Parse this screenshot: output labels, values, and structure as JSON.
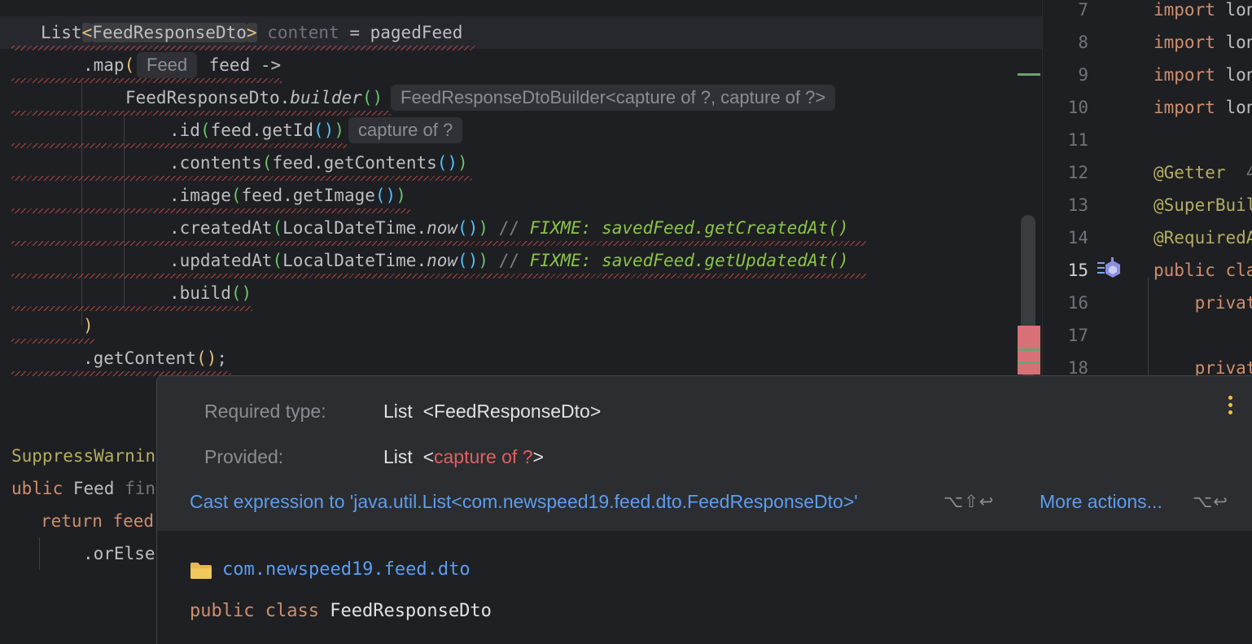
{
  "editor": {
    "lines": [
      {
        "parts": [
          {
            "t": "List"
          },
          {
            "t": "<",
            "cls": "par1 hl-bracket"
          },
          {
            "t": "FeedResponseDto",
            "cls": "hl-bracket"
          },
          {
            "t": ">",
            "cls": "par1 hl-bracket"
          },
          {
            "t": " content",
            "cls": "dim"
          },
          {
            "t": " = pagedFeed"
          }
        ]
      },
      {
        "parts": [
          {
            "t": ".map"
          },
          {
            "t": "(",
            "cls": "par1"
          }
        ]
      },
      {
        "parts": [
          {
            "t": "FeedResponseDto."
          },
          {
            "t": "builder",
            "cls": "italic"
          },
          {
            "t": "()",
            "cls": "par3"
          }
        ]
      },
      {
        "parts": [
          {
            "t": ".id"
          },
          {
            "t": "(",
            "cls": "par3"
          },
          {
            "t": "feed.getId"
          },
          {
            "t": "()",
            "cls": "par2"
          },
          {
            "t": ")",
            "cls": "par3"
          }
        ]
      },
      {
        "parts": [
          {
            "t": ".contents"
          },
          {
            "t": "(",
            "cls": "par3"
          },
          {
            "t": "feed.getContents"
          },
          {
            "t": "()",
            "cls": "par2"
          },
          {
            "t": ")",
            "cls": "par3"
          }
        ]
      },
      {
        "parts": [
          {
            "t": ".image"
          },
          {
            "t": "(",
            "cls": "par3"
          },
          {
            "t": "feed.getImage"
          },
          {
            "t": "()",
            "cls": "par2"
          },
          {
            "t": ")",
            "cls": "par3"
          }
        ]
      },
      {
        "parts": [
          {
            "t": ".createdAt"
          },
          {
            "t": "(",
            "cls": "par3"
          },
          {
            "t": "LocalDateTime."
          },
          {
            "t": "now",
            "cls": "italic"
          },
          {
            "t": "()",
            "cls": "par2"
          },
          {
            "t": ")",
            "cls": "par3"
          },
          {
            "t": " // ",
            "cls": "cmt"
          },
          {
            "t": "FIXME: savedFeed.getCreatedAt()",
            "cls": "todo"
          }
        ]
      },
      {
        "parts": [
          {
            "t": ".updatedAt"
          },
          {
            "t": "(",
            "cls": "par3"
          },
          {
            "t": "LocalDateTime."
          },
          {
            "t": "now",
            "cls": "italic"
          },
          {
            "t": "()",
            "cls": "par2"
          },
          {
            "t": ")",
            "cls": "par3"
          },
          {
            "t": " // ",
            "cls": "cmt"
          },
          {
            "t": "FIXME: savedFeed.getUpdatedAt()",
            "cls": "todo"
          }
        ]
      },
      {
        "parts": [
          {
            "t": ".build"
          },
          {
            "t": "()",
            "cls": "par3"
          }
        ]
      },
      {
        "parts": [
          {
            "t": ")",
            "cls": "par1"
          }
        ]
      },
      {
        "parts": [
          {
            "t": ".getContent"
          },
          {
            "t": "()",
            "cls": "par1"
          },
          {
            "t": ";"
          }
        ]
      },
      {
        "parts": [
          {
            "t": "SuppressWarnin",
            "cls": "anno"
          }
        ]
      },
      {
        "parts": [
          {
            "t": "ublic",
            "cls": "kw"
          },
          {
            "t": " Feed "
          },
          {
            "t": "fin",
            "cls": "dim"
          }
        ]
      },
      {
        "parts": [
          {
            "t": "return",
            "cls": "kw"
          },
          {
            "t": " feed",
            "cls": "kw"
          }
        ]
      },
      {
        "parts": [
          {
            "t": ".orElse"
          }
        ]
      }
    ],
    "map_lambda_param": " feed ->",
    "hints": {
      "feed_type": "Feed",
      "builder_type": "FeedResponseDtoBuilder<capture of ?, capture of ?>",
      "id_type": "capture of ?"
    }
  },
  "right_pane": {
    "rows": [
      {
        "num": "7",
        "code": [
          {
            "t": "import",
            "cls": "kw"
          },
          {
            "t": " lon"
          }
        ]
      },
      {
        "num": "8",
        "code": [
          {
            "t": "import",
            "cls": "kw"
          },
          {
            "t": " lon"
          }
        ]
      },
      {
        "num": "9",
        "code": [
          {
            "t": "import",
            "cls": "kw"
          },
          {
            "t": " lon"
          }
        ]
      },
      {
        "num": "10",
        "code": [
          {
            "t": "import",
            "cls": "kw"
          },
          {
            "t": " lon"
          }
        ]
      },
      {
        "num": "11",
        "code": []
      },
      {
        "num": "12",
        "code": [
          {
            "t": "@Getter",
            "cls": "anno"
          },
          {
            "t": "  4",
            "cls": "dim"
          }
        ]
      },
      {
        "num": "13",
        "code": [
          {
            "t": "@SuperBuil",
            "cls": "anno"
          }
        ]
      },
      {
        "num": "14",
        "code": [
          {
            "t": "@RequiredA",
            "cls": "anno"
          }
        ]
      },
      {
        "num": "15",
        "code": [
          {
            "t": "public",
            "cls": "kw"
          },
          {
            "t": " cla",
            "cls": "kw"
          }
        ]
      },
      {
        "num": "16",
        "code": [
          {
            "t": "    privat",
            "cls": "kw"
          }
        ]
      },
      {
        "num": "17",
        "code": []
      },
      {
        "num": "18",
        "code": [
          {
            "t": "    privat",
            "cls": "kw"
          }
        ]
      }
    ],
    "active_line": "15"
  },
  "popup": {
    "required_label": "Required type:",
    "required_value_prefix": "List  <",
    "required_value_type": "FeedResponseDto",
    "required_value_suffix": ">",
    "provided_label": "Provided:",
    "provided_value_prefix": "List  <",
    "provided_value_type": "capture of ?",
    "provided_value_suffix": ">",
    "cast_action": "Cast expression to 'java.util.List<com.newspeed19.feed.dto.FeedResponseDto>'",
    "cast_shortcut": "⌥⇧↩",
    "more_actions": "More actions...",
    "more_shortcut": "⌥↩",
    "package": "com.newspeed19.feed.dto",
    "decl_public": "public",
    "decl_class": "class",
    "decl_name": "FeedResponseDto"
  },
  "colors": {
    "error": "#e0605f",
    "link": "#5c9cf0",
    "keyword": "#cf8e6d"
  }
}
